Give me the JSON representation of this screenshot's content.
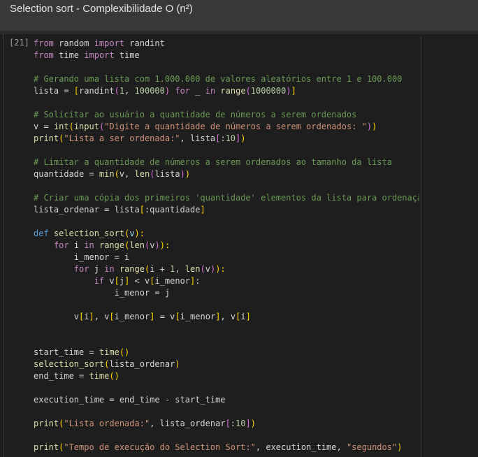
{
  "header": {
    "title": "Selection sort - Complexibilidade O (n²)"
  },
  "cell": {
    "execution_count": "[21]",
    "lines": [
      [
        [
          "keyword",
          "from"
        ],
        [
          "plain",
          " random "
        ],
        [
          "keyword",
          "import"
        ],
        [
          "plain",
          " randint"
        ]
      ],
      [
        [
          "keyword",
          "from"
        ],
        [
          "plain",
          " time "
        ],
        [
          "keyword",
          "import"
        ],
        [
          "plain",
          " time"
        ]
      ],
      [],
      [
        [
          "comment",
          "# Gerando uma lista com 1.000.000 de valores aleatórios entre 1 e 100.000"
        ]
      ],
      [
        [
          "plain",
          "lista = "
        ],
        [
          "bracket",
          "["
        ],
        [
          "plain",
          "randint"
        ],
        [
          "bracket2",
          "("
        ],
        [
          "number",
          "1"
        ],
        [
          "plain",
          ", "
        ],
        [
          "number",
          "100000"
        ],
        [
          "bracket2",
          ")"
        ],
        [
          "plain",
          " "
        ],
        [
          "keyword",
          "for"
        ],
        [
          "plain",
          " _ "
        ],
        [
          "keyword",
          "in"
        ],
        [
          "plain",
          " "
        ],
        [
          "func",
          "range"
        ],
        [
          "bracket2",
          "("
        ],
        [
          "number",
          "1000000"
        ],
        [
          "bracket2",
          ")"
        ],
        [
          "bracket",
          "]"
        ]
      ],
      [],
      [
        [
          "comment",
          "# Solicitar ao usuário a quantidade de números a serem ordenados"
        ]
      ],
      [
        [
          "plain",
          "v = "
        ],
        [
          "func",
          "int"
        ],
        [
          "bracket",
          "("
        ],
        [
          "func",
          "input"
        ],
        [
          "bracket2",
          "("
        ],
        [
          "string",
          "\"Digite a quantidade de números a serem ordenados: \""
        ],
        [
          "bracket2",
          ")"
        ],
        [
          "bracket",
          ")"
        ]
      ],
      [
        [
          "func",
          "print"
        ],
        [
          "bracket",
          "("
        ],
        [
          "string",
          "\"Lista a ser ordenada:\""
        ],
        [
          "plain",
          ", lista"
        ],
        [
          "bracket2",
          "["
        ],
        [
          "plain",
          ":"
        ],
        [
          "number",
          "10"
        ],
        [
          "bracket2",
          "]"
        ],
        [
          "bracket",
          ")"
        ]
      ],
      [],
      [
        [
          "comment",
          "# Limitar a quantidade de números a serem ordenados ao tamanho da lista"
        ]
      ],
      [
        [
          "plain",
          "quantidade = "
        ],
        [
          "func",
          "min"
        ],
        [
          "bracket",
          "("
        ],
        [
          "plain",
          "v, "
        ],
        [
          "func",
          "len"
        ],
        [
          "bracket2",
          "("
        ],
        [
          "plain",
          "lista"
        ],
        [
          "bracket2",
          ")"
        ],
        [
          "bracket",
          ")"
        ]
      ],
      [],
      [
        [
          "comment",
          "# Criar uma cópia dos primeiros 'quantidade' elementos da lista para ordenação"
        ]
      ],
      [
        [
          "plain",
          "lista_ordenar = lista"
        ],
        [
          "bracket",
          "["
        ],
        [
          "plain",
          ":quantidade"
        ],
        [
          "bracket",
          "]"
        ]
      ],
      [],
      [
        [
          "defkw",
          "def"
        ],
        [
          "plain",
          " "
        ],
        [
          "func",
          "selection_sort"
        ],
        [
          "bracket",
          "("
        ],
        [
          "param",
          "v"
        ],
        [
          "bracket",
          "):"
        ]
      ],
      [
        [
          "plain",
          "    "
        ],
        [
          "keyword",
          "for"
        ],
        [
          "plain",
          " i "
        ],
        [
          "keyword",
          "in"
        ],
        [
          "plain",
          " "
        ],
        [
          "func",
          "range"
        ],
        [
          "bracket",
          "("
        ],
        [
          "func",
          "len"
        ],
        [
          "bracket2",
          "("
        ],
        [
          "plain",
          "v"
        ],
        [
          "bracket2",
          ")"
        ],
        [
          "bracket",
          "):"
        ]
      ],
      [
        [
          "plain",
          "        i_menor = i"
        ]
      ],
      [
        [
          "plain",
          "        "
        ],
        [
          "keyword",
          "for"
        ],
        [
          "plain",
          " j "
        ],
        [
          "keyword",
          "in"
        ],
        [
          "plain",
          " "
        ],
        [
          "func",
          "range"
        ],
        [
          "bracket",
          "("
        ],
        [
          "plain",
          "i + "
        ],
        [
          "number",
          "1"
        ],
        [
          "plain",
          ", "
        ],
        [
          "func",
          "len"
        ],
        [
          "bracket2",
          "("
        ],
        [
          "plain",
          "v"
        ],
        [
          "bracket2",
          ")"
        ],
        [
          "bracket",
          "):"
        ]
      ],
      [
        [
          "plain",
          "            "
        ],
        [
          "keyword",
          "if"
        ],
        [
          "plain",
          " v"
        ],
        [
          "bracket",
          "["
        ],
        [
          "plain",
          "j"
        ],
        [
          "bracket",
          "]"
        ],
        [
          "plain",
          " < v"
        ],
        [
          "bracket",
          "["
        ],
        [
          "plain",
          "i_menor"
        ],
        [
          "bracket",
          "]"
        ],
        [
          "plain",
          ":"
        ]
      ],
      [
        [
          "plain",
          "                i_menor = j"
        ]
      ],
      [],
      [
        [
          "plain",
          "        v"
        ],
        [
          "bracket",
          "["
        ],
        [
          "plain",
          "i"
        ],
        [
          "bracket",
          "]"
        ],
        [
          "plain",
          ", v"
        ],
        [
          "bracket",
          "["
        ],
        [
          "plain",
          "i_menor"
        ],
        [
          "bracket",
          "]"
        ],
        [
          "plain",
          " = v"
        ],
        [
          "bracket",
          "["
        ],
        [
          "plain",
          "i_menor"
        ],
        [
          "bracket",
          "]"
        ],
        [
          "plain",
          ", v"
        ],
        [
          "bracket",
          "["
        ],
        [
          "plain",
          "i"
        ],
        [
          "bracket",
          "]"
        ]
      ],
      [],
      [],
      [
        [
          "plain",
          "start_time = "
        ],
        [
          "func",
          "time"
        ],
        [
          "bracket",
          "()"
        ]
      ],
      [
        [
          "func",
          "selection_sort"
        ],
        [
          "bracket",
          "("
        ],
        [
          "plain",
          "lista_ordenar"
        ],
        [
          "bracket",
          ")"
        ]
      ],
      [
        [
          "plain",
          "end_time = "
        ],
        [
          "func",
          "time"
        ],
        [
          "bracket",
          "()"
        ]
      ],
      [],
      [
        [
          "plain",
          "execution_time = end_time - start_time"
        ]
      ],
      [],
      [
        [
          "func",
          "print"
        ],
        [
          "bracket",
          "("
        ],
        [
          "string",
          "\"Lista ordenada:\""
        ],
        [
          "plain",
          ", lista_ordenar"
        ],
        [
          "bracket2",
          "["
        ],
        [
          "plain",
          ":"
        ],
        [
          "number",
          "10"
        ],
        [
          "bracket2",
          "]"
        ],
        [
          "bracket",
          ")"
        ]
      ],
      [],
      [
        [
          "func",
          "print"
        ],
        [
          "bracket",
          "("
        ],
        [
          "string",
          "\"Tempo de execução do Selection Sort:\""
        ],
        [
          "plain",
          ", execution_time, "
        ],
        [
          "string",
          "\"segundos\""
        ],
        [
          "bracket",
          ")"
        ]
      ]
    ]
  }
}
